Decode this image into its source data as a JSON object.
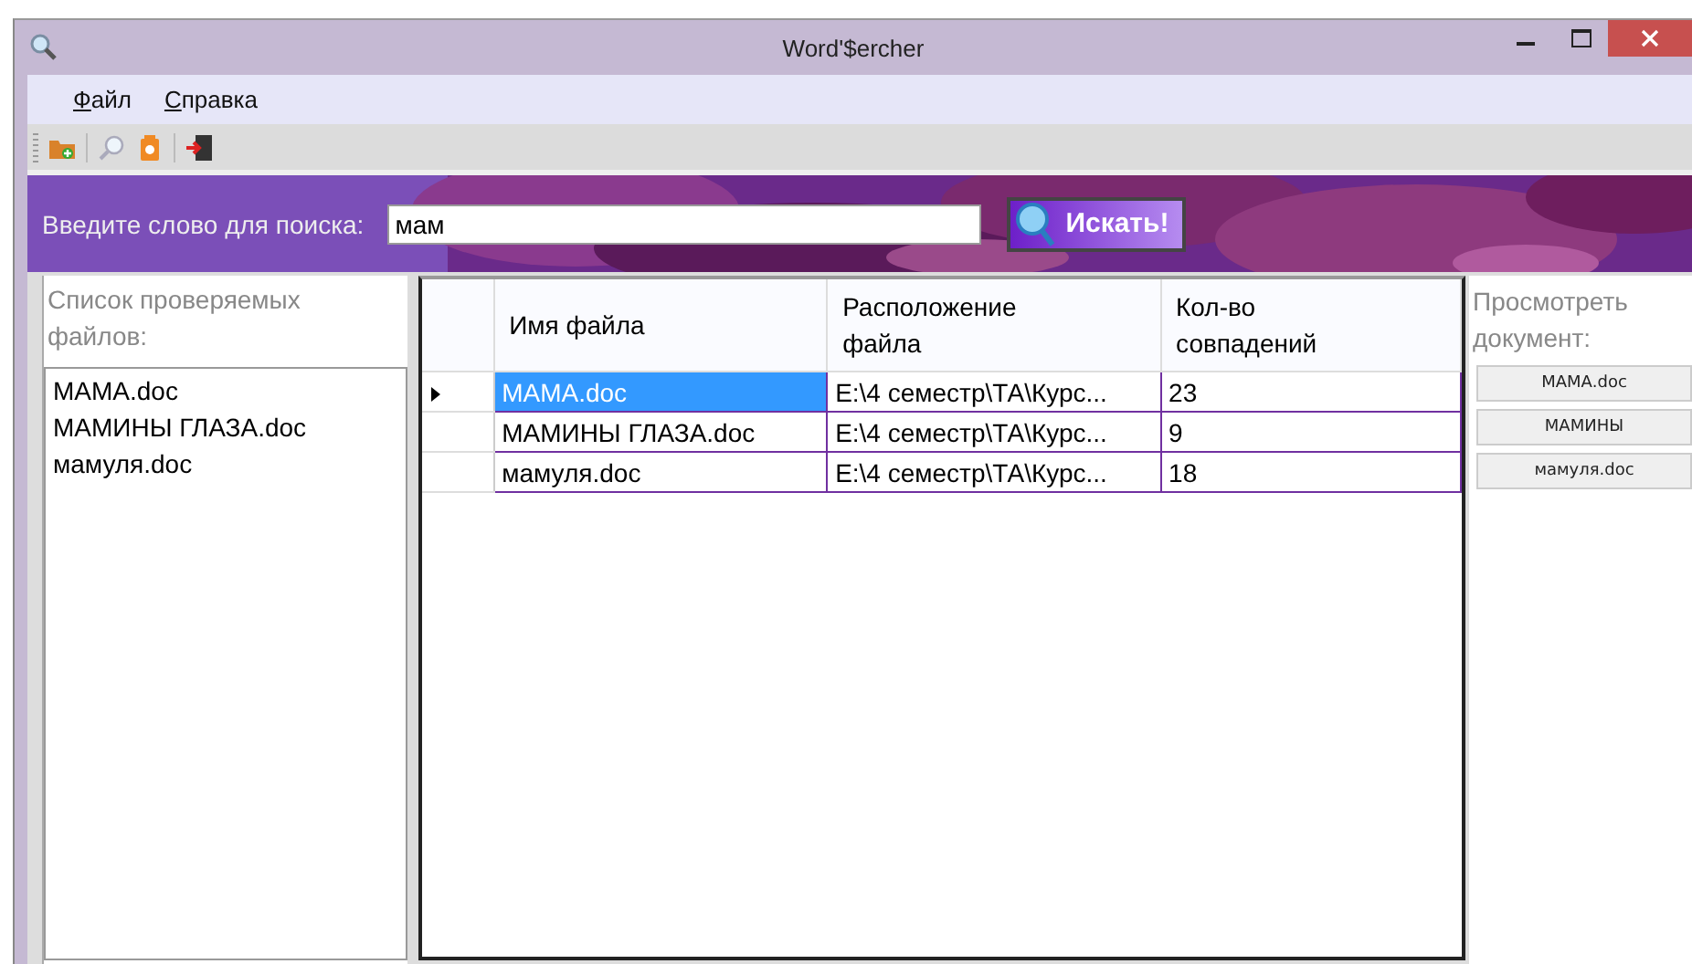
{
  "window": {
    "title": "Word'$ercher"
  },
  "menu": [
    {
      "label": "Файл"
    },
    {
      "label": "Справка"
    }
  ],
  "search": {
    "label": "Введите слово для поиска:",
    "value": "мам",
    "button": "Искать!"
  },
  "files": {
    "label": "Список проверяемых файлов:",
    "items": [
      "МАМА.doc",
      "МАМИНЫ ГЛАЗА.doc",
      "мамуля.doc"
    ]
  },
  "table": {
    "columns": [
      "Имя файла",
      "Расположение файла",
      "Кол-во совпадений"
    ],
    "rows": [
      {
        "selected": true,
        "cells": [
          "МАМА.doc",
          "E:\\4 семестр\\ТА\\Курс...",
          "23"
        ]
      },
      {
        "selected": false,
        "cells": [
          "МАМИНЫ ГЛАЗА.doc",
          "E:\\4 семестр\\ТА\\Курс...",
          "9"
        ]
      },
      {
        "selected": false,
        "cells": [
          "мамуля.doc",
          "E:\\4 семестр\\ТА\\Курс...",
          "18"
        ]
      }
    ]
  },
  "view": {
    "label": "Просмотреть документ:",
    "buttons": [
      "МАМА.doc",
      "МАМИНЫ",
      "мамуля.doc"
    ]
  }
}
